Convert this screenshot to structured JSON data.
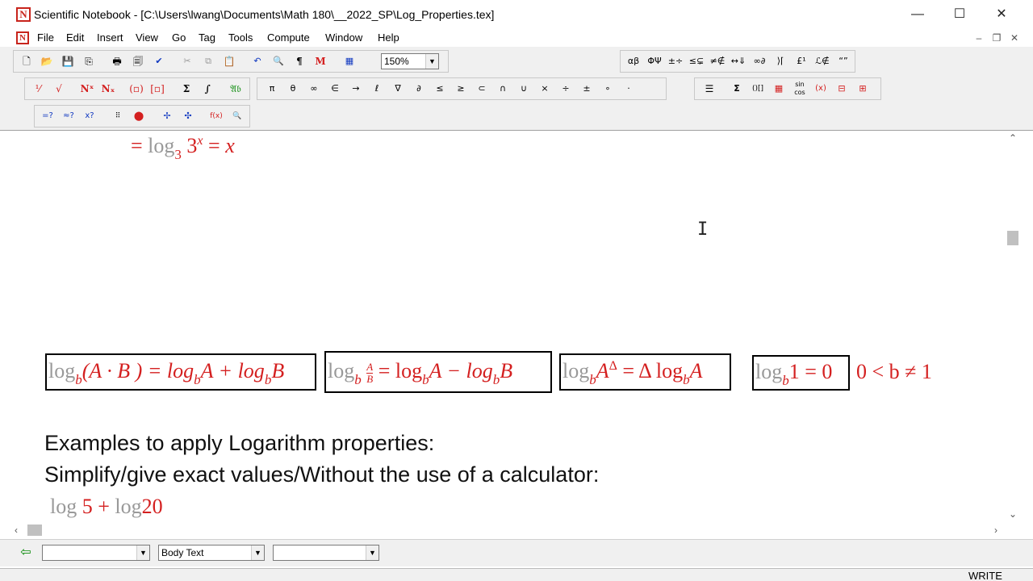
{
  "window": {
    "title": "Scientific Notebook - [C:\\Users\\lwang\\Documents\\Math 180\\__2022_SP\\Log_Properties.tex]",
    "app_icon_letter": "N",
    "minimize_glyph": "—",
    "maximize_glyph": "☐",
    "close_glyph": "✕"
  },
  "menu": {
    "items": [
      "File",
      "Edit",
      "Insert",
      "View",
      "Go",
      "Tag",
      "Tools",
      "Compute",
      "Window",
      "Help"
    ],
    "mdi_minimize": "–",
    "mdi_restore": "❐",
    "mdi_close": "✕"
  },
  "toolbar": {
    "zoom": "150%",
    "standard_icons": [
      "new-file-icon",
      "open-folder-icon",
      "save-icon",
      "save-all-icon",
      "print-icon",
      "print-preview-icon",
      "spell-check-icon",
      "cut-icon",
      "copy-icon",
      "paste-icon",
      "undo-icon",
      "find-icon",
      "pilcrow-icon",
      "math-toggle-icon",
      "table-icon"
    ],
    "m_label": "M",
    "pilcrow": "¶",
    "symbol_panels": [
      "αβ",
      "ΦΨ",
      "±÷",
      "≤⊊",
      "≠∉",
      "↔⇓",
      "∞∂",
      "⟩⌈",
      "£¹",
      "ℒ∉",
      "“”"
    ],
    "math_templates": [
      "fraction",
      "radical",
      "superscript",
      "subscript",
      "brackets",
      "matrix",
      "sum",
      "integral",
      "fraktur"
    ],
    "math_template_labels": {
      "superscript": "Nˣ",
      "subscript": "Nₓ",
      "sum": "Σ",
      "integral": "∫",
      "fraktur": "𝔄𝔟"
    },
    "common_symbols": [
      "π",
      "θ",
      "∞",
      "∈",
      "→",
      "ℓ",
      "∇",
      "∂",
      "≤",
      "≥",
      "⊂",
      "∩",
      "∪",
      "×",
      "÷",
      "±",
      "∘",
      "·"
    ],
    "compute_right": [
      "Σ",
      "()[]",
      "sin cos",
      "(x)"
    ],
    "compute_row3": [
      "evaluate",
      "evaluate-numeric",
      "simplify",
      "matrix-compute",
      "stop-compute",
      "plot-2d",
      "plot-3d",
      "define-function",
      "show-definitions"
    ]
  },
  "document": {
    "top_equation": {
      "prefix": "=",
      "log": "log",
      "base": "3",
      "num": "3",
      "exp": "x",
      "eq": "=",
      "rhs": "x"
    },
    "properties": [
      {
        "parts": [
          "log",
          "b",
          "(A · B ) = log",
          "b",
          "A + log",
          "b",
          "B"
        ]
      },
      {
        "parts": [
          "log",
          "b",
          "A",
          "B",
          "= log",
          "b",
          "A − log",
          "b",
          "B"
        ]
      },
      {
        "parts": [
          "log",
          "b",
          "A",
          "Δ",
          "= Δ log",
          "b",
          "A"
        ]
      },
      {
        "parts": [
          "log",
          "b",
          "1 = 0"
        ]
      }
    ],
    "condition": "0 < b ≠ 1",
    "heading1": "Examples to apply Logarithm properties:",
    "heading2": "Simplify/give exact values/Without the use of a calculator:",
    "example": {
      "log1": "log",
      "n1": "5",
      "plus": "+",
      "log2": "log",
      "n2": "20"
    }
  },
  "bottombar": {
    "tag1": "",
    "tag2": "Body Text",
    "tag3": "",
    "status": "WRITE"
  },
  "colors": {
    "math_red": "#d42020",
    "frame": "#000000",
    "toolbar_bg": "#f0f0f0"
  }
}
